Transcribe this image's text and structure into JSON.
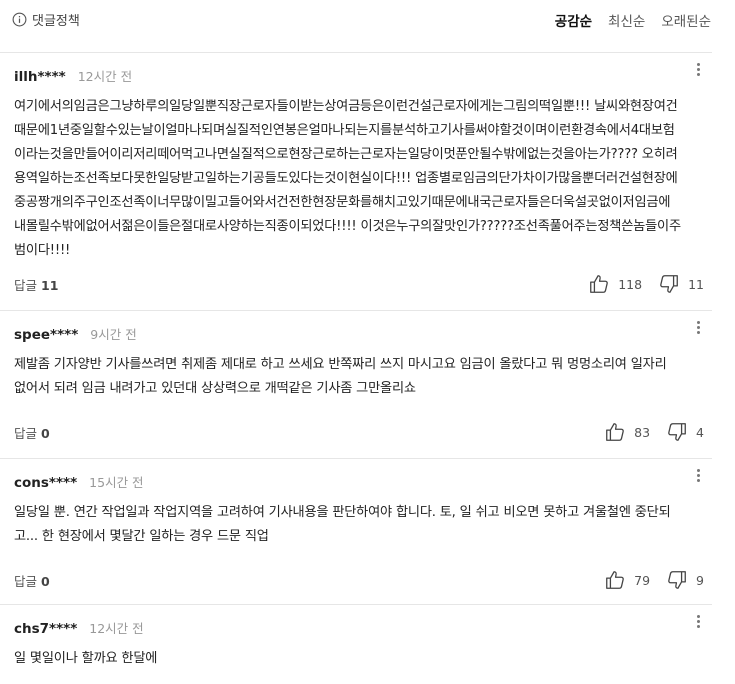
{
  "policy_label": "댓글정책",
  "sort": [
    "공감순",
    "최신순",
    "오래된순"
  ],
  "reply_label": "답글",
  "comments": [
    {
      "author": "illh****",
      "time": "12시간 전",
      "text": "여기에서의임금은그냥하루의일당일뿐직장근로자들이받는상여금등은이런건설근로자에게는그림의떡일뿐!!! 날씨와현장여건때문에1년중일할수있는날이얼마나되며실질적인연봉은얼마나되는지를분석하고기사를써야할것이며이런환경속에서4대보험이라는것을만들어이리저리떼어먹고나면실질적으로현장근로하는근로자는일당이멋푼안될수밖에없는것을아는가???? 오히려용역일하는조선족보다못한일당받고일하는기공들도있다는것이현실이다!!! 업종별로임금의단가차이가많을뿐더러건설현장에중공짱개의주구인조선족이너무많이밀고들어와서건전한현장문화를해치고있기때문에내국근로자들은더욱설곳없이저임금에내몰릴수밖에없어서젊은이들은절대로사양하는직종이되었다!!!! 이것은누구의잘맛인가?????조선족풀어주는정책쓴놈들이주범이다!!!!",
      "replies": "11",
      "likes": "118",
      "dislikes": "11"
    },
    {
      "author": "spee****",
      "time": "9시간 전",
      "text": "제발좀 기자양반 기사를쓰려면 취제좀 제대로 하고 쓰세요 반쪽짜리 쓰지 마시고요 임금이 올랐다고 뭐 멍멍소리여 일자리 없어서 되려 임금 내려가고 있던대 상상력으로 개떡같은 기사좀 그만올리쇼",
      "replies": "0",
      "likes": "83",
      "dislikes": "4"
    },
    {
      "author": "cons****",
      "time": "15시간 전",
      "text": "일당일 뿐. 연간 작업일과 작업지역을 고려하여 기사내용을 판단하여야 합니다. 토, 일 쉬고 비오면 못하고 겨울철엔 중단되고... 한 현장에서 몇달간 일하는 경우 드문 직업",
      "replies": "0",
      "likes": "79",
      "dislikes": "9"
    },
    {
      "author": "chs7****",
      "time": "12시간 전",
      "text": "일 몇일이나 할까요 한달에",
      "replies": "",
      "likes": "",
      "dislikes": ""
    }
  ]
}
